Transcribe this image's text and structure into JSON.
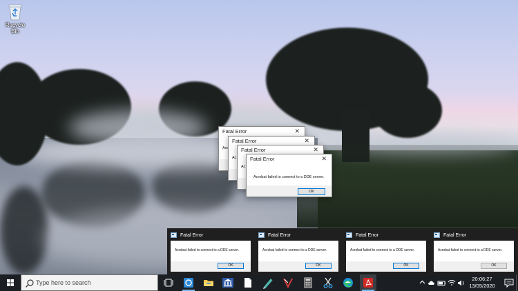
{
  "desktop": {
    "recycle_bin_label": "Recycle Bin"
  },
  "dialogs": {
    "title": "Fatal Error",
    "peek_text": "Acrob",
    "peek_text_short": "Ac",
    "message": "Acrobat failed to connect to a DDE server.",
    "ok_label": "OK",
    "close_glyph": "✕"
  },
  "previews": [
    {
      "title": "Fatal Error",
      "message": "Acrobat failed to connect to a DDE server.",
      "ok_label": "OK"
    },
    {
      "title": "Fatal Error",
      "message": "Acrobat failed to connect to a DDE server.",
      "ok_label": "OK"
    },
    {
      "title": "Fatal Error",
      "message": "Acrobat failed to connect to a DDE server.",
      "ok_label": "OK"
    },
    {
      "title": "Fatal Error",
      "message": "Acrobat failed to connect to a DDE server.",
      "ok_label": "OK"
    }
  ],
  "taskbar": {
    "search_placeholder": "Type here to search",
    "apps": [
      "task-view-icon",
      "wallpaper-app-icon",
      "file-explorer-icon",
      "bank-icon",
      "notepad-icon",
      "pen-app-icon",
      "devtool-icon",
      "calculator-icon",
      "snipping-tool-icon",
      "edge-icon",
      "acrobat-icon"
    ],
    "tray_icons": [
      "chevron-up-icon",
      "onedrive-icon",
      "battery-icon",
      "wifi-icon",
      "volume-icon"
    ],
    "time": "20:06:27",
    "date": "13/05/2020"
  },
  "colors": {
    "taskbar_bg": "#1b1f24",
    "accent": "#0078d7",
    "preview_bg": "#1f1f1f"
  }
}
